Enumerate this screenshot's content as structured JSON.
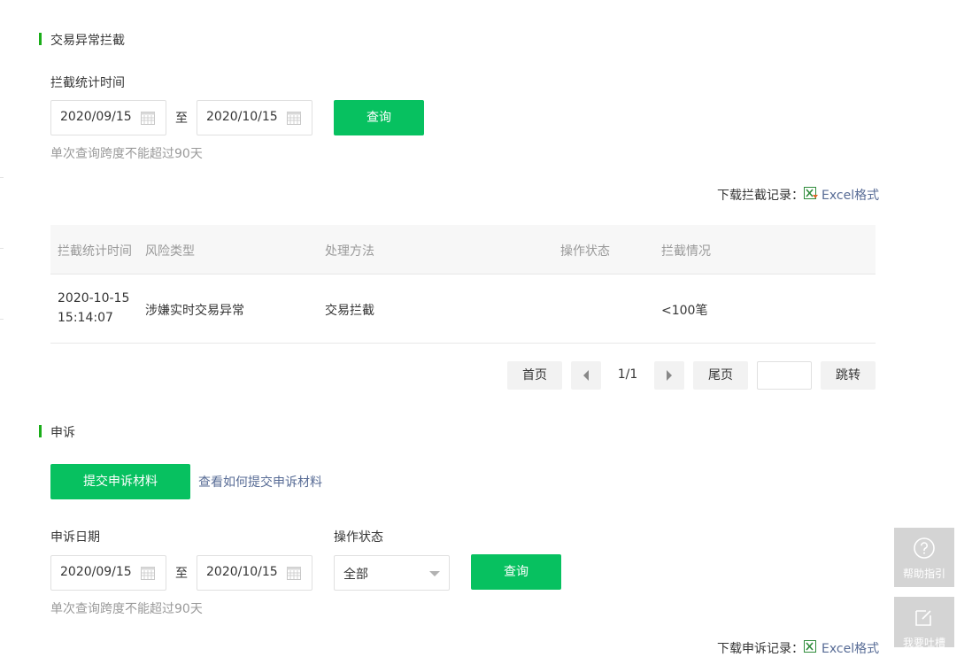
{
  "intercept": {
    "section_title": "交易异常拦截",
    "time_label": "拦截统计时间",
    "start_date": "2020/09/15",
    "to_label": "至",
    "end_date": "2020/10/15",
    "query_label": "查询",
    "hint": "单次查询跨度不能超过90天",
    "download_label": "下载拦截记录：",
    "excel_label": "Excel格式",
    "columns": [
      "拦截统计时间",
      "风险类型",
      "处理方法",
      "操作状态",
      "拦截情况"
    ],
    "rows": [
      {
        "time_date": "2020-10-15",
        "time_clock": "15:14:07",
        "risk_type": "涉嫌实时交易异常",
        "method": "交易拦截",
        "status": "",
        "situation": "<100笔"
      }
    ],
    "pagination": {
      "first": "首页",
      "page": "1/1",
      "last": "尾页",
      "jump": "跳转",
      "jump_value": ""
    }
  },
  "appeal": {
    "section_title": "申诉",
    "submit_label": "提交申诉材料",
    "howto_label": "查看如何提交申诉材料",
    "date_label": "申诉日期",
    "start_date": "2020/09/15",
    "to_label": "至",
    "end_date": "2020/10/15",
    "status_label": "操作状态",
    "status_value": "全部",
    "query_label": "查询",
    "hint": "单次查询跨度不能超过90天",
    "download_label": "下载申诉记录：",
    "excel_label": "Excel格式"
  },
  "float": {
    "help_label": "帮助指引",
    "feedback_label": "我要吐槽"
  },
  "colors": {
    "accent": "#07c160",
    "link": "#576b95",
    "section_bar": "#1aad19"
  }
}
